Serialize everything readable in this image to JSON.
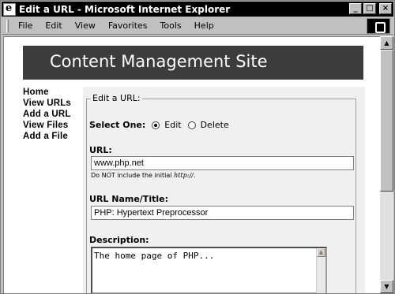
{
  "window": {
    "title": "Edit a URL - Microsoft Internet Explorer",
    "buttons": {
      "minimize": "_",
      "maximize": "□",
      "close": "×"
    }
  },
  "menu": {
    "items": [
      "File",
      "Edit",
      "View",
      "Favorites",
      "Tools",
      "Help"
    ]
  },
  "page": {
    "site_title": "Content Management Site",
    "nav": [
      "Home",
      "View URLs",
      "Add a URL",
      "View Files",
      "Add a File"
    ],
    "form": {
      "legend": "Edit a URL:",
      "select_label": "Select One:",
      "options": [
        {
          "label": "Edit",
          "checked": true
        },
        {
          "label": "Delete",
          "checked": false
        }
      ],
      "url_label": "URL:",
      "url_value": "www.php.net",
      "url_hint_prefix": "Do NOT include the initial ",
      "url_hint_em": "http://",
      "url_hint_suffix": ".",
      "name_label": "URL Name/Title:",
      "name_value": "PHP: Hypertext Preprocessor",
      "desc_label": "Description:",
      "desc_value": "The home page of PHP..."
    }
  },
  "icons": {
    "title_icon": "ie-icon",
    "throbber": "windows-logo-icon"
  }
}
